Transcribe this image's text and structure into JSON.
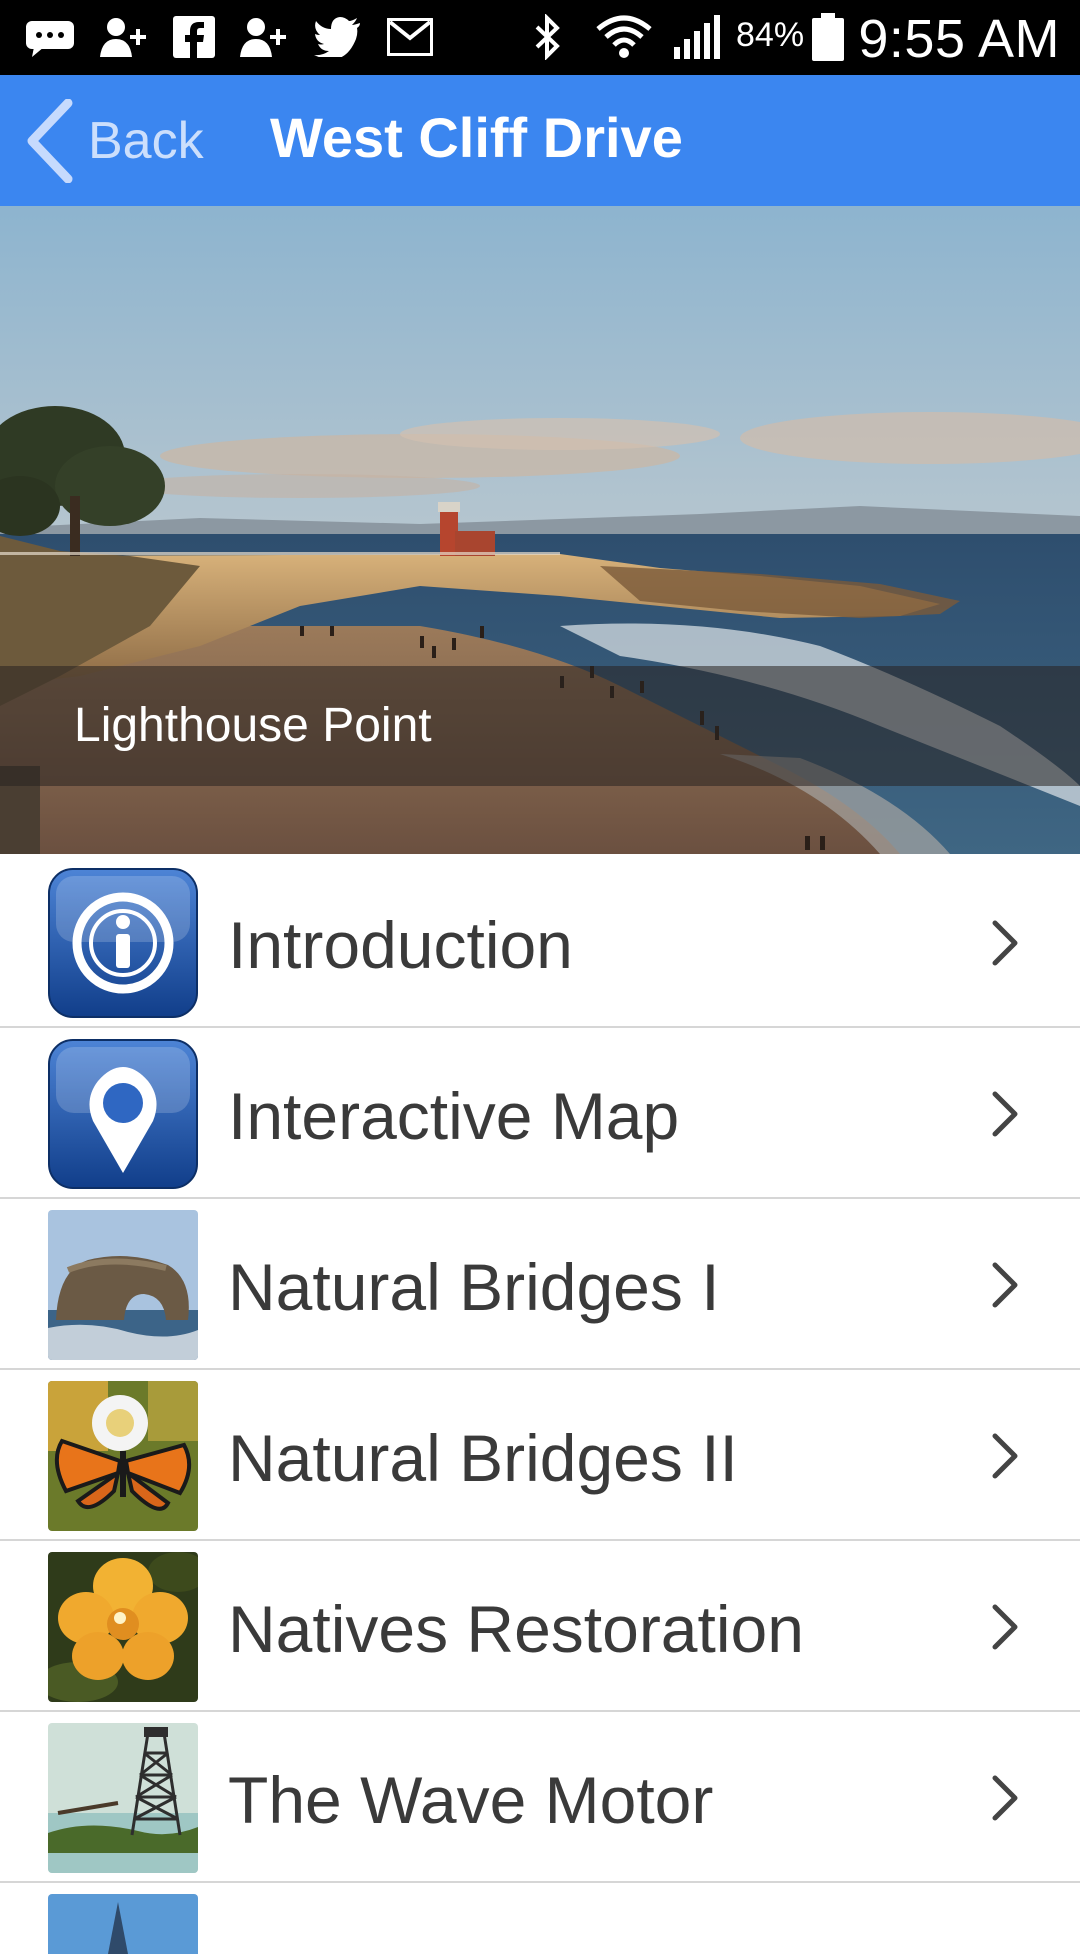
{
  "status_bar": {
    "battery_percent": "84%",
    "time": "9:55 AM",
    "icons": [
      "chat-icon",
      "add-contact-icon",
      "facebook-icon",
      "add-contact-icon",
      "twitter-icon",
      "gmail-icon",
      "bluetooth-icon",
      "wifi-icon",
      "signal-icon",
      "battery-icon"
    ]
  },
  "app_bar": {
    "back_label": "Back",
    "title": "West Cliff Drive",
    "color": "#3b86f0"
  },
  "hero": {
    "caption": "Lighthouse Point"
  },
  "list": {
    "items": [
      {
        "label": "Introduction",
        "icon": "info-icon"
      },
      {
        "label": "Interactive Map",
        "icon": "map-pin-icon"
      },
      {
        "label": "Natural Bridges I",
        "icon": "rock-arch-photo"
      },
      {
        "label": "Natural Bridges II",
        "icon": "monarch-butterfly-photo"
      },
      {
        "label": "Natives Restoration",
        "icon": "yellow-flower-photo"
      },
      {
        "label": "The Wave Motor",
        "icon": "wave-motor-tower-photo"
      }
    ]
  }
}
